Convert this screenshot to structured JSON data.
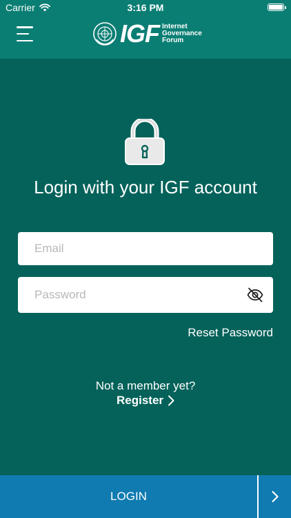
{
  "status_bar": {
    "carrier": "Carrier",
    "time": "3:16 PM"
  },
  "header": {
    "logo_mark": "IGF",
    "logo_lines": [
      "Internet",
      "Governance",
      "Forum"
    ]
  },
  "login": {
    "title": "Login with your IGF account",
    "email_placeholder": "Email",
    "password_placeholder": "Password",
    "reset_password": "Reset Password",
    "not_member": "Not a member yet?",
    "register": "Register",
    "login_button": "LOGIN"
  },
  "icons": {
    "menu": "hamburger-menu-icon",
    "lock": "padlock-icon",
    "password_toggle": "eye-slash-icon",
    "register_arrow": "chevron-right-icon",
    "login_arrow": "chevron-right-icon"
  },
  "colors": {
    "background": "#04625a",
    "header": "#0b7e74",
    "login_bar": "#0f7bb1",
    "field": "#ffffff",
    "text": "#ffffff"
  }
}
